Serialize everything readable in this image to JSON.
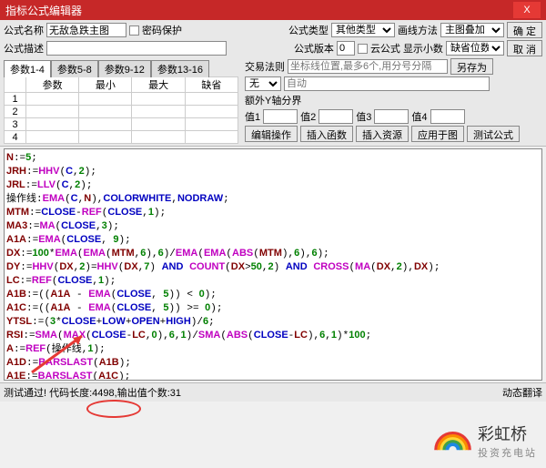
{
  "titlebar": {
    "title": "指标公式编辑器",
    "close": "X"
  },
  "row1": {
    "name_lbl": "公式名称",
    "name_val": "无敌急跌主图",
    "pwd_chk": "密码保护",
    "type_lbl": "公式类型",
    "type_val": "其他类型",
    "draw_lbl": "画线方法",
    "draw_val": "主图叠加",
    "ok": "确 定"
  },
  "row2": {
    "desc_lbl": "公式描述",
    "desc_val": "",
    "ver_lbl": "公式版本",
    "ver_val": "0",
    "cloud": "云公式",
    "dec_lbl": "显示小数",
    "dec_val": "缺省位数",
    "cancel": "取 消"
  },
  "row3": {
    "rule_lbl": "交易法则",
    "rule_hint": "坐标线位置,最多6个,用分号分隔",
    "saveas": "另存为"
  },
  "row4": {
    "none": "无",
    "auto": "自动"
  },
  "row5": {
    "extra": "额外Y轴分界",
    "v1": "值1",
    "v2": "值2",
    "v3": "值3",
    "v4": "值4"
  },
  "btns": {
    "edit": "编辑操作",
    "func": "插入函数",
    "res": "插入资源",
    "apply": "应用于图",
    "test": "测试公式"
  },
  "tabs": {
    "t1": "参数1-4",
    "t2": "参数5-8",
    "t3": "参数9-12",
    "t4": "参数13-16"
  },
  "paramhdr": {
    "c1": "参数",
    "c2": "最小",
    "c3": "最大",
    "c4": "缺省"
  },
  "rows": [
    "1",
    "2",
    "3",
    "4"
  ],
  "status": {
    "left": "测试通过! 代码长度:4498,输出值个数:31",
    "right": "动态翻译"
  },
  "logo": {
    "name": "彩虹桥",
    "sub": "投资充电站"
  },
  "chart_data": null
}
